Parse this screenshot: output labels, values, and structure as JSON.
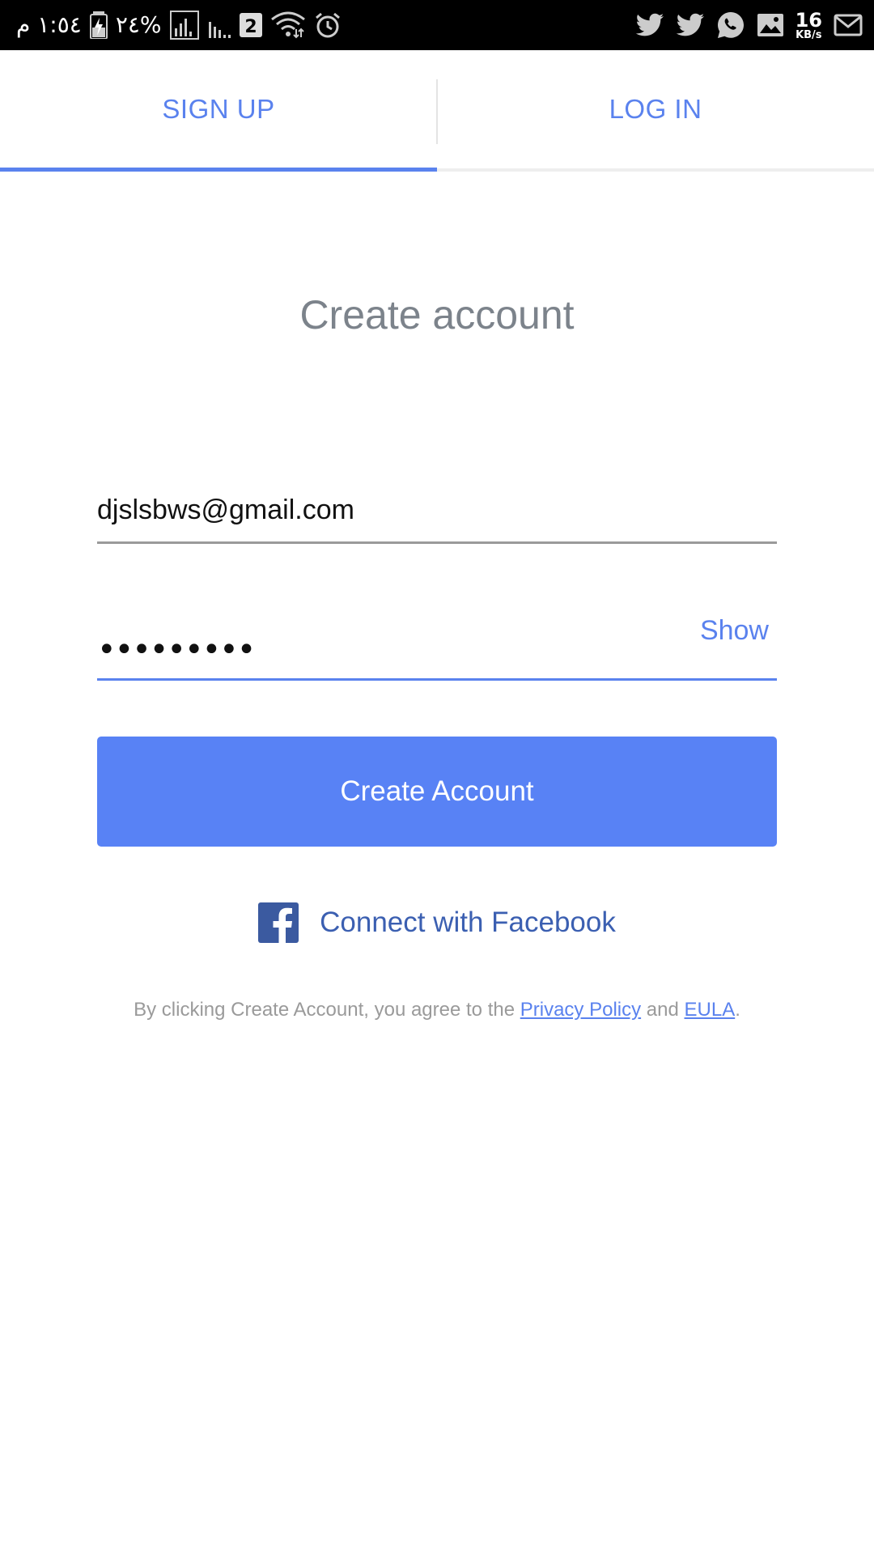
{
  "status_bar": {
    "time": "١:٥٤ م",
    "battery_percent": "%٢٤",
    "sim_badge": "2",
    "net_speed_value": "16",
    "net_speed_unit": "KB/s",
    "left_icons": [
      "battery-charging-icon",
      "signal-1-icon",
      "signal-2-icon",
      "sim-2-icon",
      "wifi-icon",
      "alarm-icon"
    ],
    "right_icons": [
      "twitter-icon",
      "twitter-icon",
      "whatsapp-icon",
      "image-icon",
      "mail-icon"
    ]
  },
  "tabs": [
    {
      "label": "SIGN UP",
      "active": true
    },
    {
      "label": "LOG IN",
      "active": false
    }
  ],
  "title": "Create account",
  "form": {
    "email_value": "djslsbws@gmail.com",
    "password_masked": "•••••••••",
    "show_label": "Show",
    "submit_label": "Create Account"
  },
  "facebook": {
    "label": "Connect with Facebook",
    "icon": "facebook-icon"
  },
  "legal": {
    "prefix": "By clicking Create Account, you agree to the ",
    "privacy_link": "Privacy Policy",
    "conjunction": " and ",
    "eula_link": "EULA",
    "suffix": "."
  },
  "colors": {
    "accent": "#5a82ee",
    "button": "#5882f5",
    "facebook": "#3b5aa0",
    "title_gray": "#7c838b"
  }
}
